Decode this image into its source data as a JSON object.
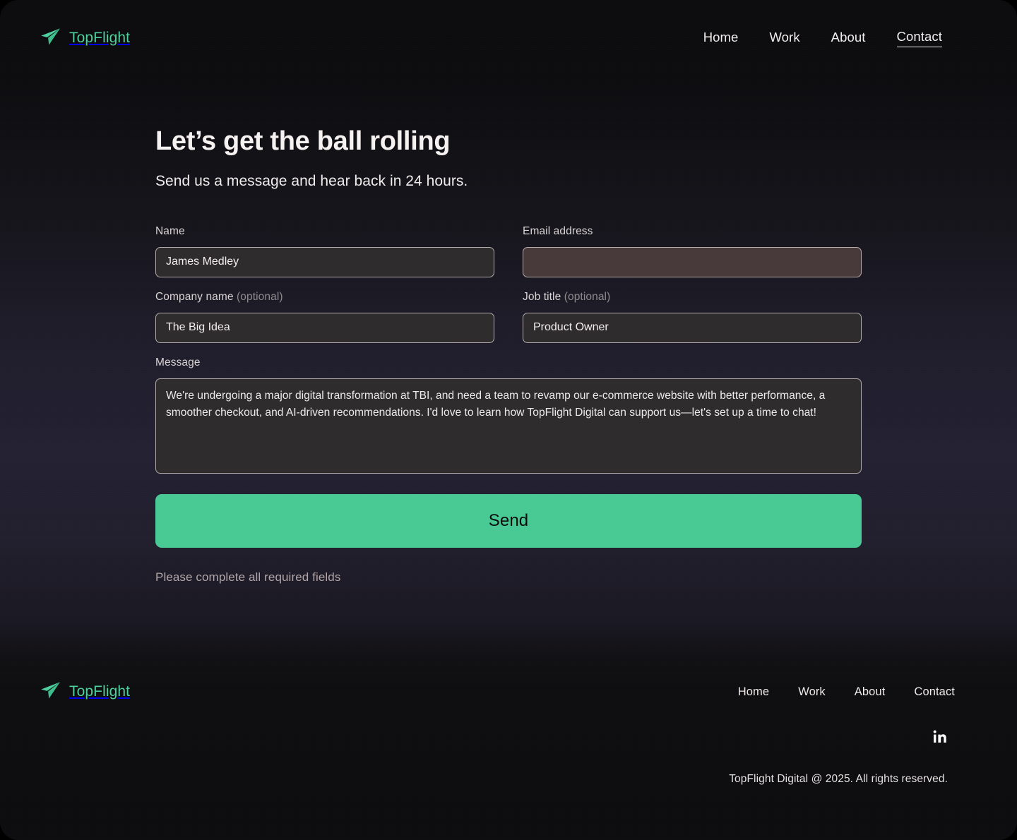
{
  "brand": {
    "name": "TopFlight",
    "logo_icon": "paper-plane-icon",
    "accent_color": "#4ecf9d"
  },
  "header": {
    "nav": [
      {
        "label": "Home",
        "active": false
      },
      {
        "label": "Work",
        "active": false
      },
      {
        "label": "About",
        "active": false
      },
      {
        "label": "Contact",
        "active": true
      }
    ]
  },
  "main": {
    "title": "Let’s get the ball rolling",
    "subtitle": "Send us a message and hear back in 24 hours.",
    "form": {
      "name": {
        "label": "Name",
        "value": "James Medley",
        "placeholder": "",
        "error": false
      },
      "email": {
        "label": "Email address",
        "value": "",
        "placeholder": "",
        "error": true,
        "error_fill_color": "#48393a"
      },
      "company": {
        "label": "Company name",
        "optional_suffix": " (optional)",
        "value": "The Big Idea",
        "placeholder": "",
        "error": false
      },
      "job_title": {
        "label": "Job title",
        "optional_suffix": " (optional)",
        "value": "Product Owner",
        "placeholder": "",
        "error": false
      },
      "message": {
        "label": "Message",
        "value": "We're undergoing a major digital transformation at TBI, and need a team to revamp our e-commerce website with better performance, a smoother checkout, and AI-driven recommendations. I'd love to learn how TopFlight Digital can support us—let's set up a time to chat!",
        "placeholder": ""
      },
      "submit_label": "Send",
      "submit_color": "#49c994",
      "error_message": "Please complete all required fields"
    }
  },
  "footer": {
    "brand_name": "TopFlight",
    "nav": [
      {
        "label": "Home"
      },
      {
        "label": "Work"
      },
      {
        "label": "About"
      },
      {
        "label": "Contact"
      }
    ],
    "social": [
      {
        "name": "linkedin-icon",
        "label": "in"
      }
    ],
    "copyright": "TopFlight Digital @ 2025. All rights reserved."
  }
}
